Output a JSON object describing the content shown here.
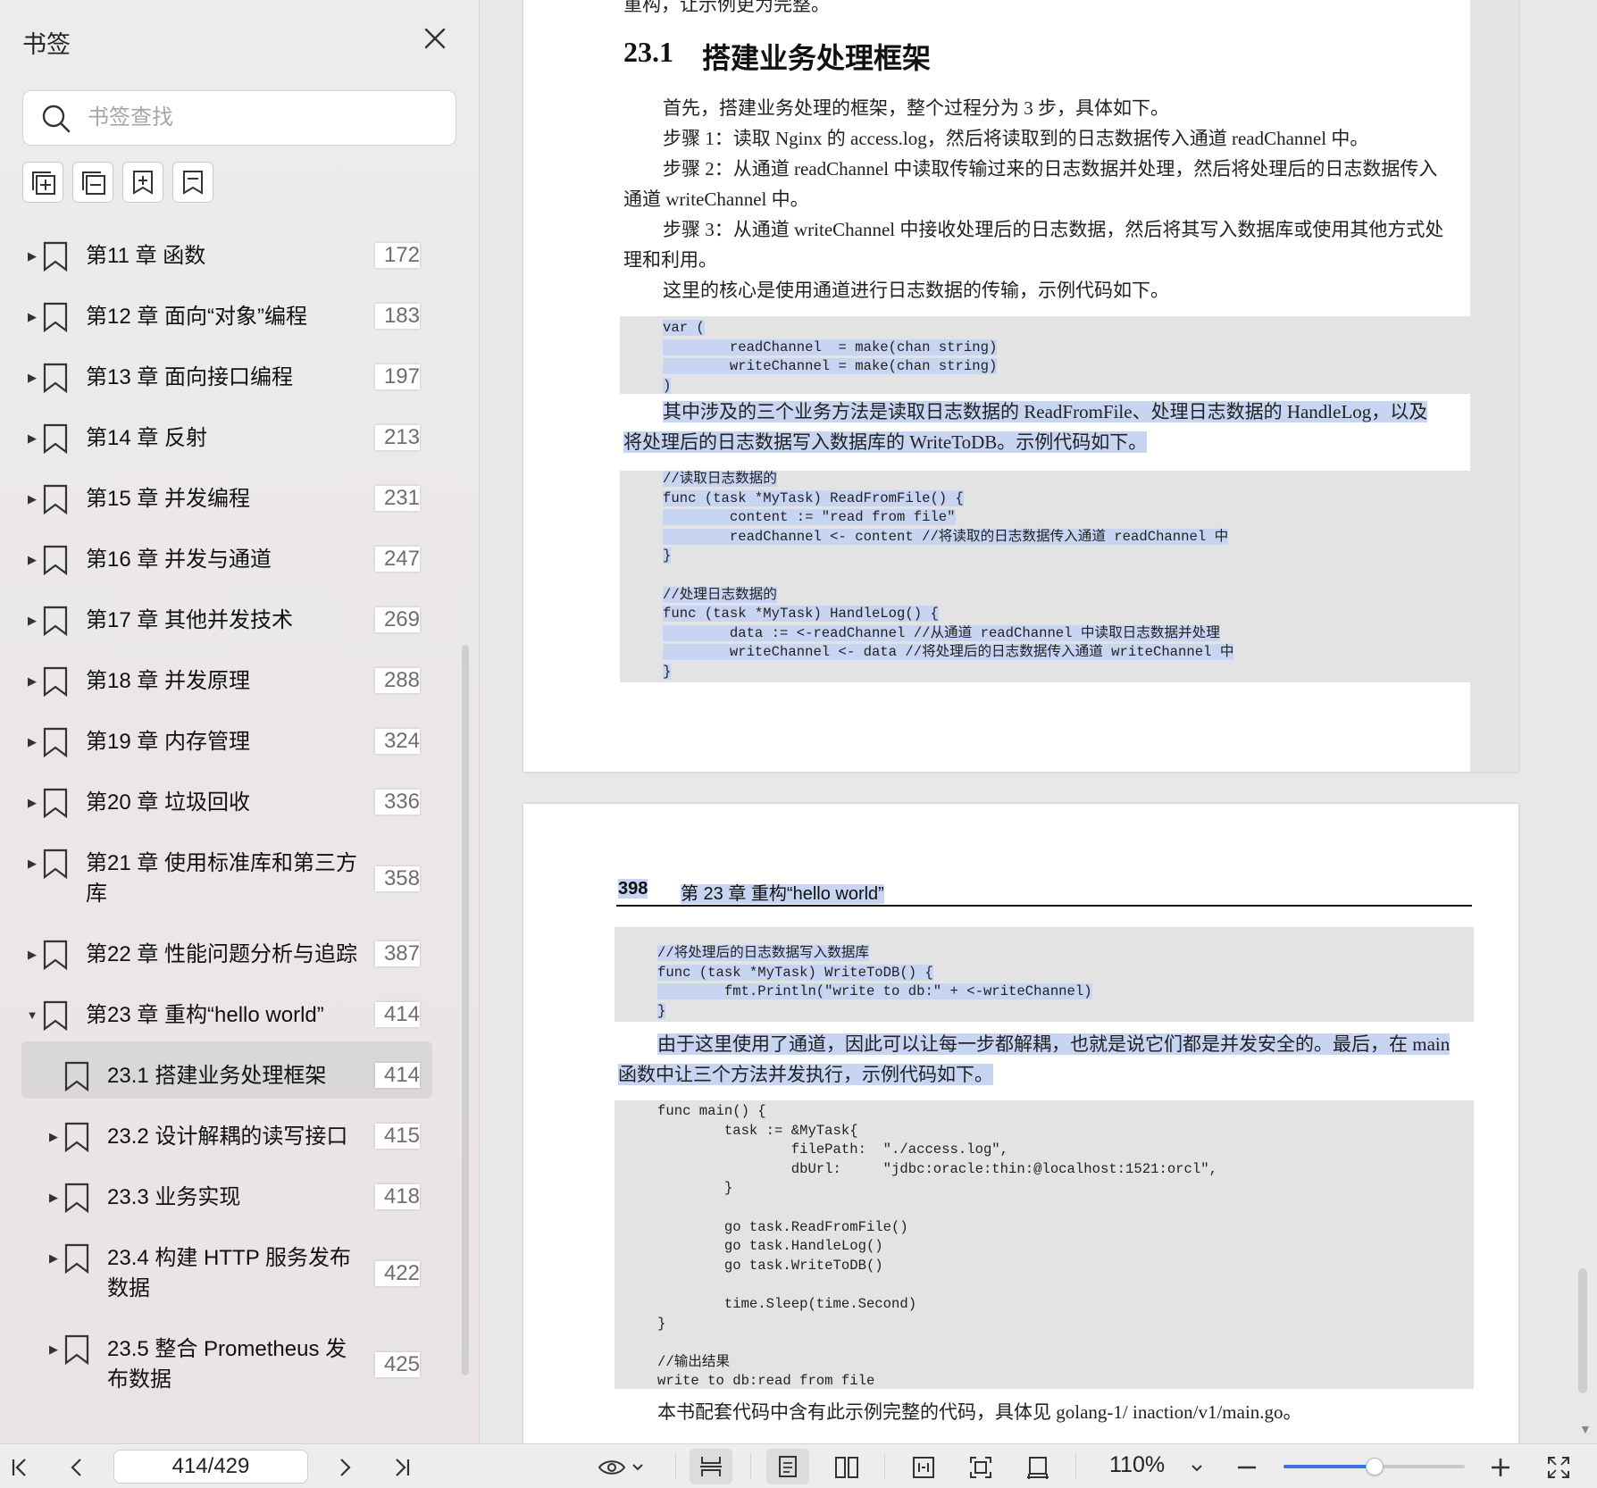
{
  "sidebar": {
    "title": "书签",
    "search_placeholder": "书签查找",
    "tool_icons": [
      "expand-all-icon",
      "collapse-all-icon",
      "add-bookmark-icon",
      "bookmark-icon"
    ],
    "items": [
      {
        "label": "第11 章 函数",
        "page": "172",
        "expanded": false,
        "level": 0
      },
      {
        "label": "第12 章 面向“对象”编程",
        "page": "183",
        "expanded": false,
        "level": 0
      },
      {
        "label": "第13 章 面向接口编程",
        "page": "197",
        "expanded": false,
        "level": 0
      },
      {
        "label": "第14 章 反射",
        "page": "213",
        "expanded": false,
        "level": 0
      },
      {
        "label": "第15 章 并发编程",
        "page": "231",
        "expanded": false,
        "level": 0
      },
      {
        "label": "第16 章 并发与通道",
        "page": "247",
        "expanded": false,
        "level": 0
      },
      {
        "label": "第17 章 其他并发技术",
        "page": "269",
        "expanded": false,
        "level": 0
      },
      {
        "label": "第18 章 并发原理",
        "page": "288",
        "expanded": false,
        "level": 0
      },
      {
        "label": "第19 章 内存管理",
        "page": "324",
        "expanded": false,
        "level": 0
      },
      {
        "label": "第20 章 垃圾回收",
        "page": "336",
        "expanded": false,
        "level": 0
      },
      {
        "label_line1": "第21 章 使用标准库和第三方",
        "label_line2": "库",
        "page": "358",
        "expanded": false,
        "level": 0
      },
      {
        "label": "第22 章 性能问题分析与追踪",
        "page": "387",
        "expanded": false,
        "level": 0
      },
      {
        "label": "第23 章 重构“hello world”",
        "page": "414",
        "expanded": true,
        "level": 0
      },
      {
        "label": "23.1  搭建业务处理框架",
        "page": "414",
        "selected": true,
        "level": 1
      },
      {
        "label": "23.2  设计解耦的读写接口",
        "page": "415",
        "expanded": false,
        "level": 1
      },
      {
        "label": "23.3  业务实现",
        "page": "418",
        "expanded": false,
        "level": 1
      },
      {
        "label_line1": "23.4  构建 HTTP 服务发布",
        "label_line2": "数据",
        "page": "422",
        "expanded": false,
        "level": 1
      },
      {
        "label_line1": "23.5  整合 Prometheus 发",
        "label_line2": "布数据",
        "page": "425",
        "expanded": false,
        "level": 1
      }
    ]
  },
  "document": {
    "page1": {
      "top_fragment": "重构，让示例更为完整。",
      "section_number": "23.1",
      "section_title": "搭建业务处理框架",
      "intro": "首先，搭建业务处理的框架，整个过程分为 3 步，具体如下。",
      "step1": "步骤 1：读取 Nginx 的 access.log，然后将读取到的日志数据传入通道 readChannel 中。",
      "step2_a": "步骤 2：从通道 readChannel 中读取传输过来的日志数据并处理，然后将处理后的日志数据传入",
      "step2_b": "通道 writeChannel 中。",
      "step3_a": "步骤 3：从通道 writeChannel 中接收处理后的日志数据，然后将其写入数据库或使用其他方式处",
      "step3_b": "理和利用。",
      "core": "这里的核心是使用通道进行日志数据的传输，示例代码如下。",
      "code1": [
        "var (",
        "        readChannel  = make(chan string)",
        "        writeChannel = make(chan string)",
        ")"
      ],
      "desc_a": "其中涉及的三个业务方法是读取日志数据的 ReadFromFile、处理日志数据的 HandleLog，以及",
      "desc_b": "将处理后的日志数据写入数据库的 WriteToDB。示例代码如下。",
      "code2": [
        "//读取日志数据的",
        "func (task *MyTask) ReadFromFile() {",
        "        content := \"read from file\"",
        "        readChannel <- content //将读取的日志数据传入通道 readChannel 中",
        "}",
        "",
        "//处理日志数据的",
        "func (task *MyTask) HandleLog() {",
        "        data := <-readChannel //从通道 readChannel 中读取日志数据并处理",
        "        writeChannel <- data //将处理后的日志数据传入通道 writeChannel 中",
        "}"
      ]
    },
    "page2": {
      "page_number": "398",
      "running_head": "第 23 章   重构“hello world”",
      "code3": [
        "//将处理后的日志数据写入数据库",
        "func (task *MyTask) WriteToDB() {",
        "        fmt.Println(\"write to db:\" + <-writeChannel)",
        "}"
      ],
      "para_a": "由于这里使用了通道，因此可以让每一步都解耦，也就是说它们都是并发安全的。最后，在 main",
      "para_b": "函数中让三个方法并发执行，示例代码如下。",
      "code4": [
        "func main() {",
        "        task := &MyTask{",
        "                filePath:  \"./access.log\",",
        "                dbUrl:     \"jdbc:oracle:thin:@localhost:1521:orcl\",",
        "        }",
        "",
        "        go task.ReadFromFile()",
        "        go task.HandleLog()",
        "        go task.WriteToDB()",
        "",
        "        time.Sleep(time.Second)",
        "}",
        "",
        "//输出结果",
        "write to db:read from file"
      ],
      "footer": "本书配套代码中含有此示例完整的代码，具体见 golang-1/ inaction/v1/main.go。"
    }
  },
  "toolbar": {
    "page_indicator": "414/429",
    "zoom": "110%",
    "zoom_fraction": 0.5,
    "icons": [
      "first-page-icon",
      "prev-page-icon",
      "next-page-icon",
      "last-page-icon",
      "view-mode-icon",
      "continuous-scroll-icon",
      "single-page-icon",
      "two-page-icon",
      "fit-width-icon",
      "fit-page-icon",
      "actual-size-icon",
      "zoom-out-icon",
      "zoom-in-icon",
      "fullscreen-icon"
    ]
  },
  "colors": {
    "selection": "#c7d4f2",
    "accent": "#3b74e0",
    "code_bg": "#e3e3e3"
  }
}
